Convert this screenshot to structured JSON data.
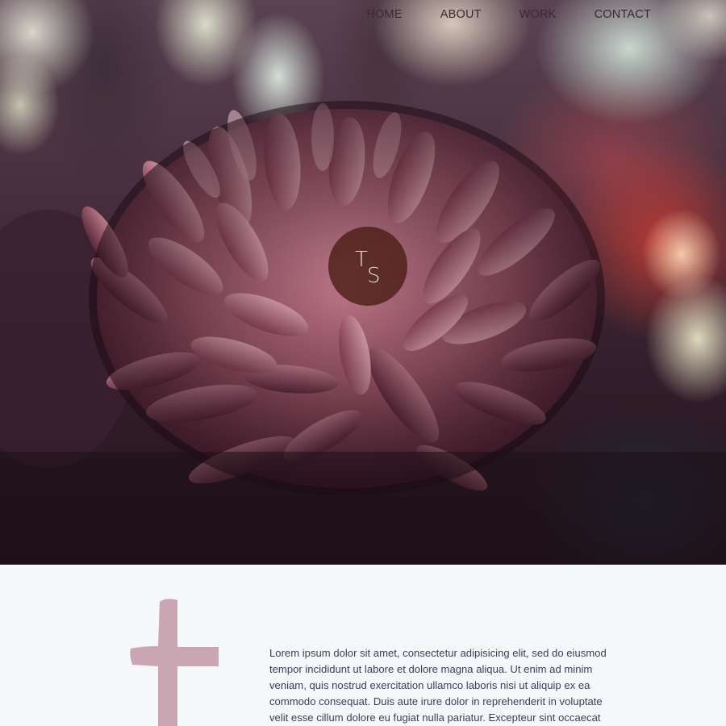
{
  "nav": {
    "items": [
      {
        "label": "HOME"
      },
      {
        "label": "ABOUT"
      },
      {
        "label": "WORK"
      },
      {
        "label": "CONTACT"
      }
    ]
  },
  "logo": {
    "letter_1": "T",
    "letter_2": "S"
  },
  "hero": {
    "image": "pink-chrysanthemum-photo"
  },
  "intro": {
    "drop_letter": "t",
    "text": "Lorem ipsum dolor sit amet, consectetur adipisicing elit, sed do eiusmod tempor incididunt ut labore et dolore magna aliqua. Ut enim ad minim veniam, quis nostrud exercitation ullamco laboris nisi ut aliquip ex ea commodo consequat. Duis aute irure dolor in reprehenderit in voluptate velit esse cillum dolore eu fugiat nulla pariatur. Excepteur sint occaecat"
  },
  "colors": {
    "nav_text": "#3a2a30",
    "logo_bg": "#481c12",
    "drop_letter": "#c9a6b2",
    "content_bg": "#f6f7fb",
    "body_text": "#3b3f55"
  }
}
